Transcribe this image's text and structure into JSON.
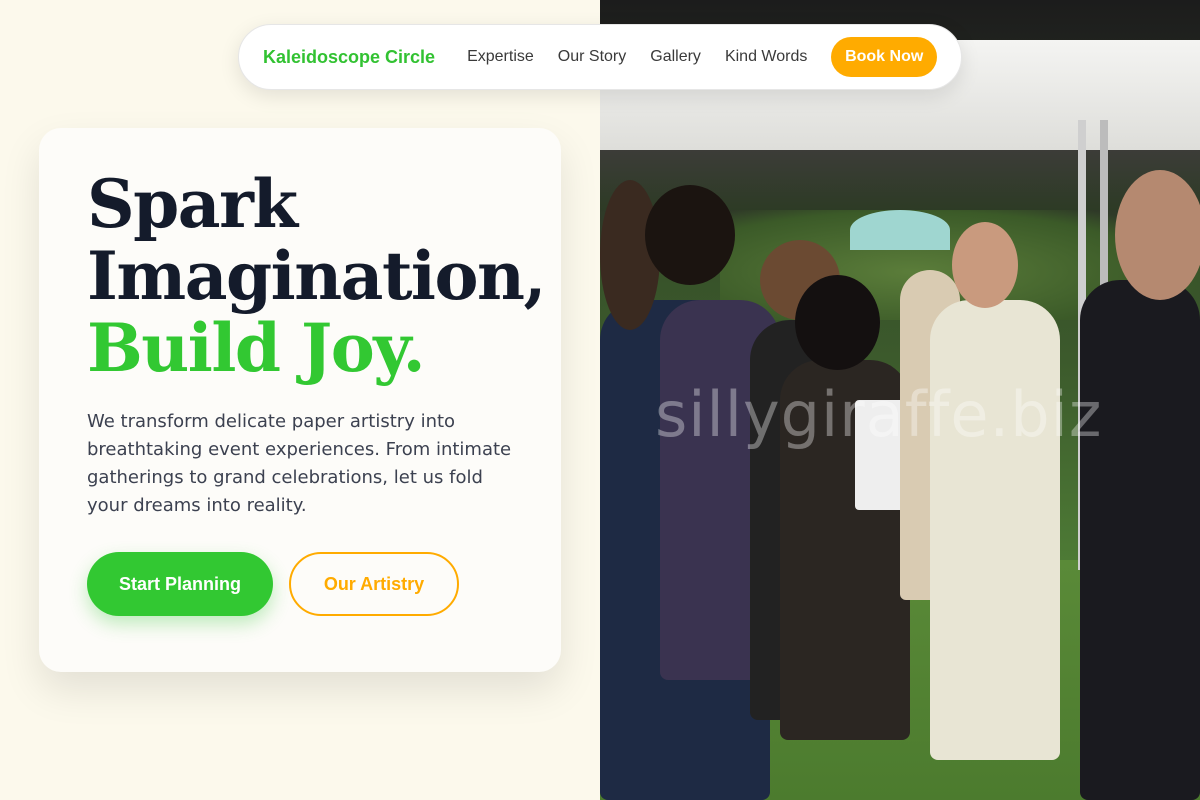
{
  "nav": {
    "brand": "Kaleidoscope Circle",
    "links": [
      "Expertise",
      "Our Story",
      "Gallery",
      "Kind Words"
    ],
    "cta": "Book Now"
  },
  "hero": {
    "headline_line1": "Spark",
    "headline_line2": "Imagination,",
    "headline_accent": "Build Joy.",
    "description": "We transform delicate paper artistry into breathtaking event experiences. From intimate gatherings to grand celebrations, let us fold your dreams into reality.",
    "primary_button": "Start Planning",
    "secondary_button": "Our Artistry"
  },
  "photo": {
    "watermark": "sillygiraffe.biz"
  },
  "colors": {
    "brand_green": "#32c832",
    "accent_orange": "#ffab00",
    "heading_navy": "#141b2b",
    "left_background": "#fcf9ec"
  }
}
